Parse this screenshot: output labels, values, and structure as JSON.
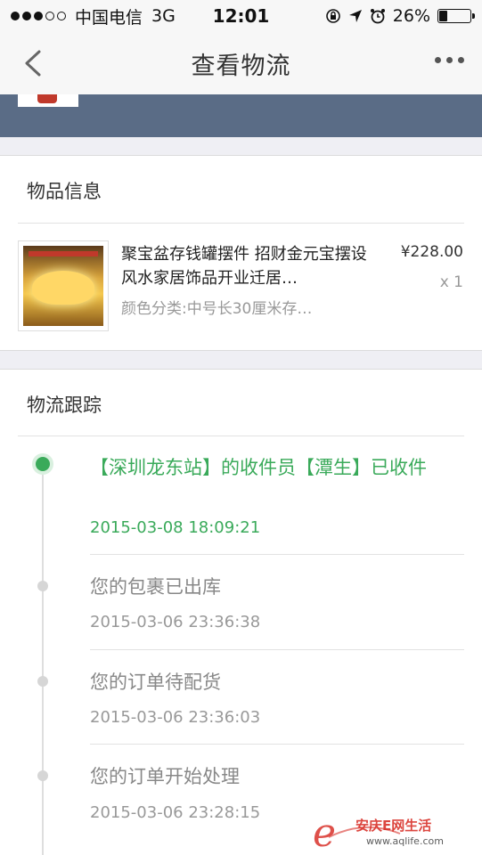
{
  "status_bar": {
    "carrier": "中国电信",
    "network": "3G",
    "time": "12:01",
    "battery": "26%",
    "battery_level": 0.26
  },
  "nav": {
    "title": "查看物流"
  },
  "product_section": {
    "title": "物品信息",
    "product": {
      "name": "聚宝盆存钱罐摆件 招财金元宝摆设 风水家居饰品开业迁居…",
      "variant": "颜色分类:中号长30厘米存…",
      "price": "¥228.00",
      "quantity": "x 1"
    }
  },
  "tracking_section": {
    "title": "物流跟踪",
    "events": [
      {
        "text": "【深圳龙东站】的收件员【潭生】已收件",
        "time": "2015-03-08 18:09:21",
        "active": true
      },
      {
        "text": "您的包裹已出库",
        "time": "2015-03-06 23:36:38",
        "active": false
      },
      {
        "text": "您的订单待配货",
        "time": "2015-03-06 23:36:03",
        "active": false
      },
      {
        "text": "您的订单开始处理",
        "time": "2015-03-06 23:28:15",
        "active": false
      }
    ]
  },
  "watermark": {
    "cn": "安庆E网生活",
    "url": "www.aqlife.com"
  },
  "colors": {
    "accent_green": "#3aaa5a",
    "banner": "#5a6c86",
    "watermark_red": "#d9322b"
  }
}
